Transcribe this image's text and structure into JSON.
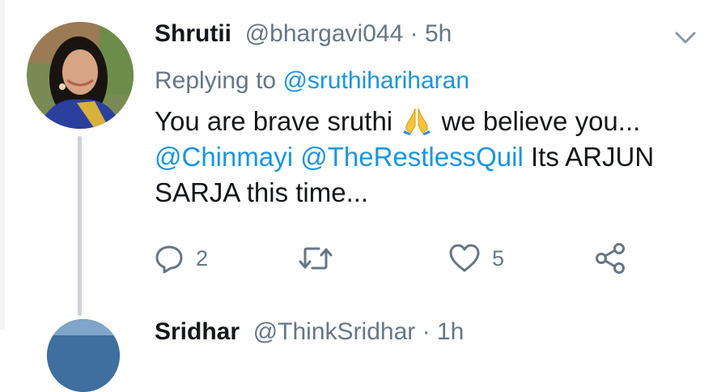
{
  "tweet": {
    "display_name": "Shrutii",
    "handle": "@bhargavi044",
    "separator": " · ",
    "time": "5h",
    "replying_prefix": "Replying to ",
    "replying_to": "@sruthihariharan",
    "text_part1": "You are brave sruthi ",
    "emoji": "folded-hands",
    "text_part2": " we believe you...",
    "mention1": "@Chinmayi",
    "mention2": "@TheRestlessQuil",
    "text_part3": " Its ARJUN SARJA this time...",
    "reply_count": "2",
    "retweet_count": "",
    "like_count": "5"
  },
  "next_tweet": {
    "display_name": "Sridhar",
    "handle": "@ThinkSridhar",
    "separator": " · ",
    "time": "1h"
  },
  "icons": {
    "reply": "reply-icon",
    "retweet": "retweet-icon",
    "like": "heart-icon",
    "share": "share-icon",
    "menu": "chevron-down-icon"
  },
  "colors": {
    "link": "#1b95e0",
    "secondary_text": "#657786",
    "primary_text": "#14171a",
    "thread_line": "#cdd3d8"
  }
}
